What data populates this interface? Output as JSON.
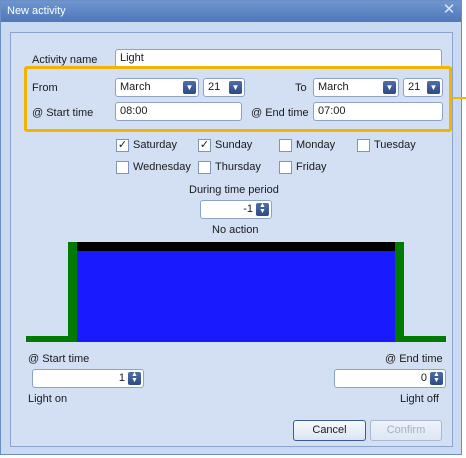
{
  "window": {
    "title": "New activity",
    "close_glyph": "✕"
  },
  "activity": {
    "label": "Activity name",
    "value": "Light"
  },
  "from": {
    "label": "From",
    "month": "March",
    "day": "21"
  },
  "to": {
    "label": "To",
    "month": "March",
    "day": "21"
  },
  "start_time": {
    "label": "@ Start time",
    "value": "08:00"
  },
  "end_time": {
    "label": "@ End time",
    "value": "07:00"
  },
  "days": [
    {
      "label": "Saturday",
      "checked": true
    },
    {
      "label": "Sunday",
      "checked": true
    },
    {
      "label": "Monday",
      "checked": false
    },
    {
      "label": "Tuesday",
      "checked": false
    },
    {
      "label": "Wednesday",
      "checked": false
    },
    {
      "label": "Thursday",
      "checked": false
    },
    {
      "label": "Friday",
      "checked": false
    }
  ],
  "period": {
    "label": "During time period",
    "value": "-1",
    "action": "No action"
  },
  "start": {
    "label": "@ Start time",
    "value": "1",
    "state": "Light on"
  },
  "end": {
    "label": "@ End time",
    "value": "0",
    "state": "Light off"
  },
  "buttons": {
    "cancel": "Cancel",
    "confirm": "Confirm"
  },
  "colors": {
    "fill": "#1a1aff",
    "edge": "#007a00",
    "top": "#000000",
    "highlight": "#f2b400"
  },
  "icons": {
    "dropdown": "dropdown-arrow-icon",
    "spinner": "spinner-arrows-icon",
    "check": "checkmark-icon"
  }
}
